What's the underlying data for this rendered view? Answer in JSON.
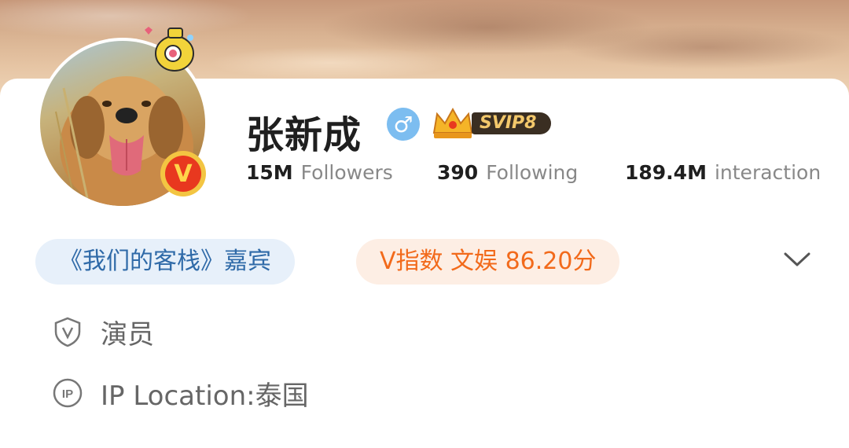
{
  "profile": {
    "name": "张新成",
    "gender_symbol": "♂",
    "vip_badge": "SVIP8",
    "verified_symbol": "V"
  },
  "stats": {
    "followers_value": "15M",
    "followers_label": "Followers",
    "following_value": "390",
    "following_label": "Following",
    "interaction_value": "189.4M",
    "interaction_label": "interaction"
  },
  "tags": {
    "show_guest": "《我们的客栈》嘉宾",
    "v_index": "V指数 文娱 86.20分"
  },
  "info": {
    "occupation": "演员",
    "ip_location": "IP Location:泰国"
  },
  "icons": {
    "occupation": "shield-v-icon",
    "ip": "ip-circle-icon",
    "expand": "chevron-down-icon"
  },
  "colors": {
    "verified": "#e8381f",
    "gender": "#7cbdf0",
    "tag_blue_text": "#2f6aa8",
    "tag_orange_text": "#f26a1b"
  }
}
